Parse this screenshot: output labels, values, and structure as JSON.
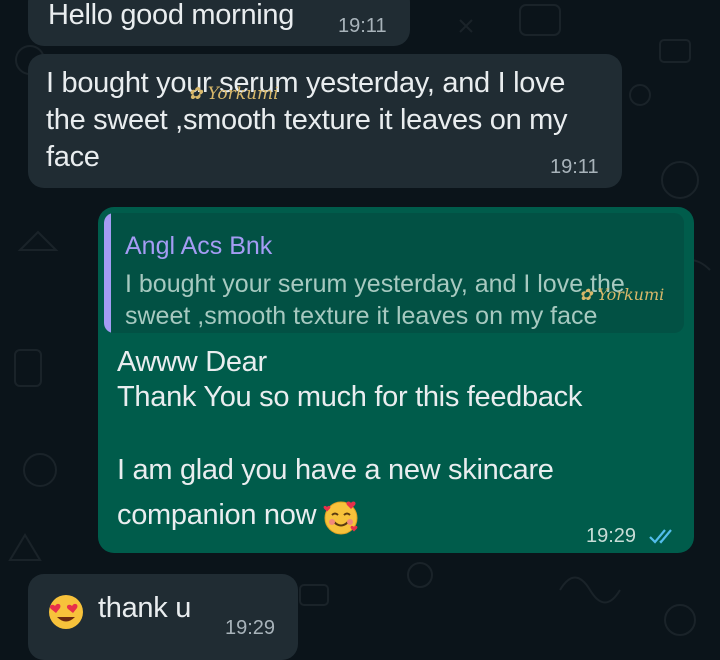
{
  "messages": {
    "m1": {
      "text": "Hello good morning",
      "time": "19:11"
    },
    "m2": {
      "text": "I bought your serum yesterday, and I love\nthe sweet ,smooth texture it leaves on my\nface",
      "time": "19:11"
    },
    "m3": {
      "quoted_author": "Angl Acs Bnk",
      "quoted_text": "I bought your serum yesterday, and I love the sweet ,smooth texture it leaves on my face",
      "line1": "Awww Dear",
      "line2": "Thank You so much for this feedback",
      "line3": "I am glad you have a new skincare",
      "line4": "companion now",
      "time": "19:29",
      "status": "read"
    },
    "m4": {
      "text": "thank u",
      "time": "19:29"
    }
  },
  "watermark": {
    "brand": "Yorkumi"
  },
  "icons": {
    "read_tick": "double-check-icon",
    "emoji_hearts": "smiling-face-with-hearts",
    "emoji_heart_eyes": "heart-eyes-face"
  },
  "colors": {
    "background": "#0b141a",
    "incoming_bubble": "#202c33",
    "outgoing_bubble": "#005c4b",
    "quote_author": "#a59cf4",
    "read_tick": "#53bdeb"
  }
}
